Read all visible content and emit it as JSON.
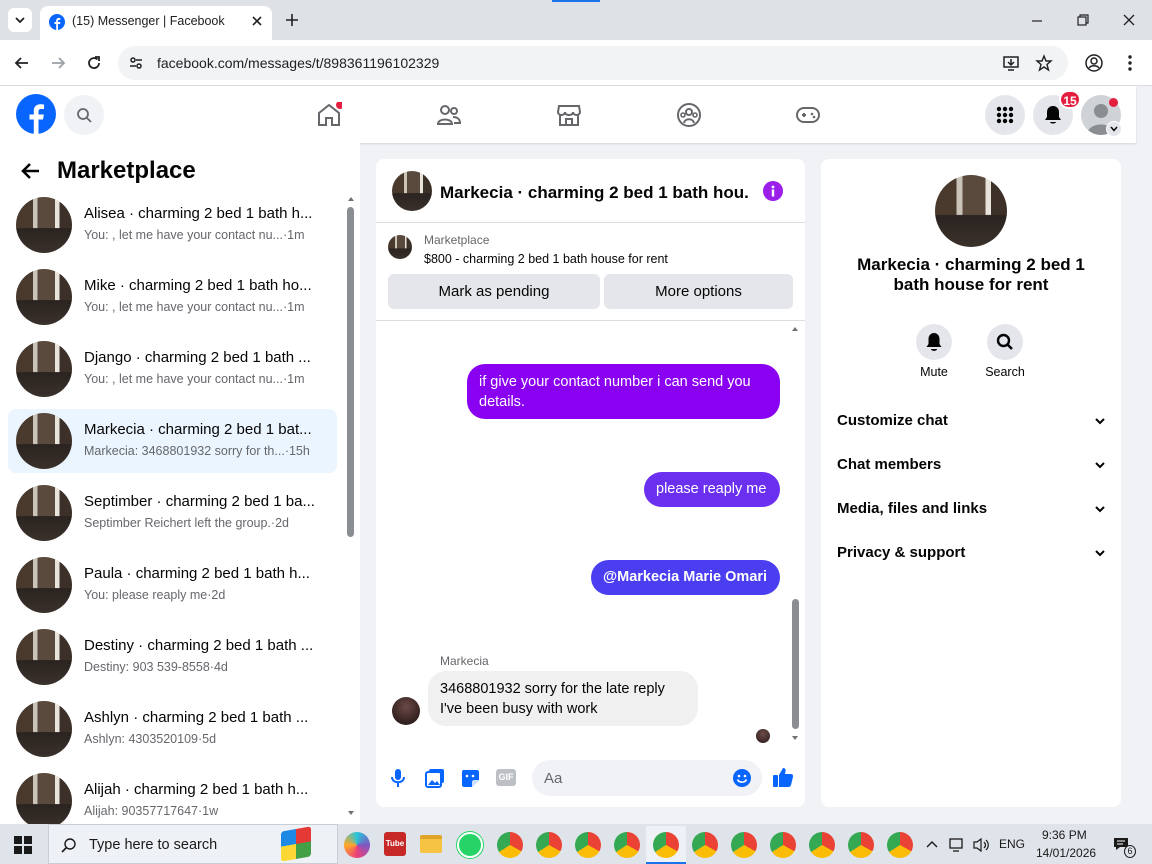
{
  "browser": {
    "tab_title": "(15) Messenger | Facebook",
    "url": "facebook.com/messages/t/898361196102329"
  },
  "fb": {
    "notification_count": "15"
  },
  "left": {
    "title": "Marketplace",
    "chats": [
      {
        "name": "Alisea · charming 2 bed 1 bath h...",
        "preview": "You: , let me have your contact nu...",
        "time": "·1m",
        "active": false
      },
      {
        "name": "Mike · charming 2 bed 1 bath ho...",
        "preview": "You: , let me have your contact nu...",
        "time": "·1m",
        "active": false
      },
      {
        "name": "Django · charming 2 bed 1 bath ...",
        "preview": "You: , let me have your contact nu...",
        "time": "·1m",
        "active": false
      },
      {
        "name": "Markecia · charming 2 bed 1 bat...",
        "preview": "Markecia: 3468801932 sorry for th...",
        "time": "·15h",
        "active": true
      },
      {
        "name": "Septimber · charming 2 bed 1 ba...",
        "preview": "Septimber Reichert left the group.",
        "time": "·2d",
        "active": false
      },
      {
        "name": "Paula · charming 2 bed 1 bath h...",
        "preview": "You: please reaply me",
        "time": "·2d",
        "active": false
      },
      {
        "name": "Destiny · charming 2 bed 1 bath ...",
        "preview": "Destiny: 903 539-8558",
        "time": "·4d",
        "active": false
      },
      {
        "name": "Ashlyn · charming 2 bed 1 bath ...",
        "preview": "Ashlyn: 4303520109",
        "time": "·5d",
        "active": false
      },
      {
        "name": "Alijah · charming 2 bed 1 bath h...",
        "preview": "Alijah: 90357717647",
        "time": "·1w",
        "active": false
      }
    ]
  },
  "conversation": {
    "title": "Markecia · charming 2 bed 1 bath hou...",
    "listing_source": "Marketplace",
    "listing_title": "$800 - charming 2 bed 1 bath house for rent",
    "btn_pending": "Mark as pending",
    "btn_more": "More options",
    "messages": [
      {
        "from": "me",
        "text": "if give your contact number  i can send you details."
      },
      {
        "from": "me",
        "text": "please reaply me"
      },
      {
        "from": "me",
        "text": "@Markecia Marie Omari"
      },
      {
        "from": "Markecia",
        "sender_label": "Markecia",
        "text": "3468801932 sorry for the late reply I've been busy with work"
      }
    ],
    "composer_placeholder": "Aa"
  },
  "details": {
    "name": "Markecia · charming 2 bed 1 bath house for rent",
    "mute_label": "Mute",
    "search_label": "Search",
    "sections": [
      "Customize chat",
      "Chat members",
      "Media, files and links",
      "Privacy & support"
    ]
  },
  "taskbar": {
    "search_placeholder": "Type here to search",
    "lang": "ENG",
    "time": "9:36 PM",
    "date": "14/01/2026",
    "notif_count": "6"
  },
  "colors": {
    "fb_blue": "#0866ff",
    "bubble_purple": "#8a00f0",
    "bubble_violet": "#6b2ff0",
    "bubble_indigo": "#4a3ef0"
  }
}
